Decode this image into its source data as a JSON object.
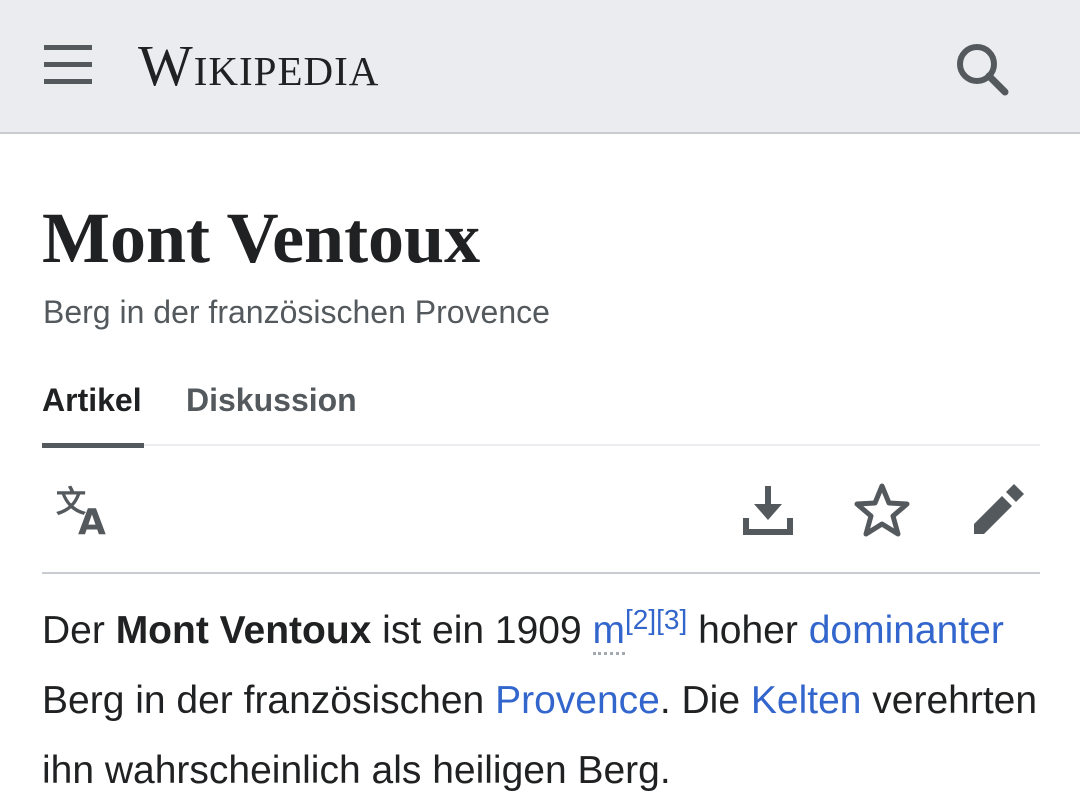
{
  "header": {
    "menu_icon": "hamburger-menu-icon",
    "wordmark": "Wikipedia",
    "search_icon": "search-icon"
  },
  "article": {
    "title": "Mont Ventoux",
    "description": "Berg in der französischen Provence"
  },
  "tabs": [
    {
      "label": "Artikel",
      "selected": true
    },
    {
      "label": "Diskussion",
      "selected": false
    }
  ],
  "toolbar": {
    "language_icon": "language-translate-icon",
    "download_icon": "download-icon",
    "watch_icon": "star-outline-icon",
    "edit_icon": "pencil-edit-icon"
  },
  "lead": {
    "t1": "Der ",
    "bold": "Mont Ventoux",
    "t2": " ist ein 1909 ",
    "link_m": "m",
    "ref2": "[2]",
    "ref3": "[3]",
    "t3": " hoher ",
    "link_dominanter": "dominanter",
    "t4": " Berg in der französischen ",
    "link_provence": "Provence",
    "t5": ". Die ",
    "link_kelten": "Kelten",
    "t6": " verehrten ihn wahrscheinlich als heiligen Berg."
  },
  "colors": {
    "header_bg": "#eaecf0",
    "link": "#3366cc",
    "text": "#202122",
    "secondary_text": "#54595d"
  }
}
